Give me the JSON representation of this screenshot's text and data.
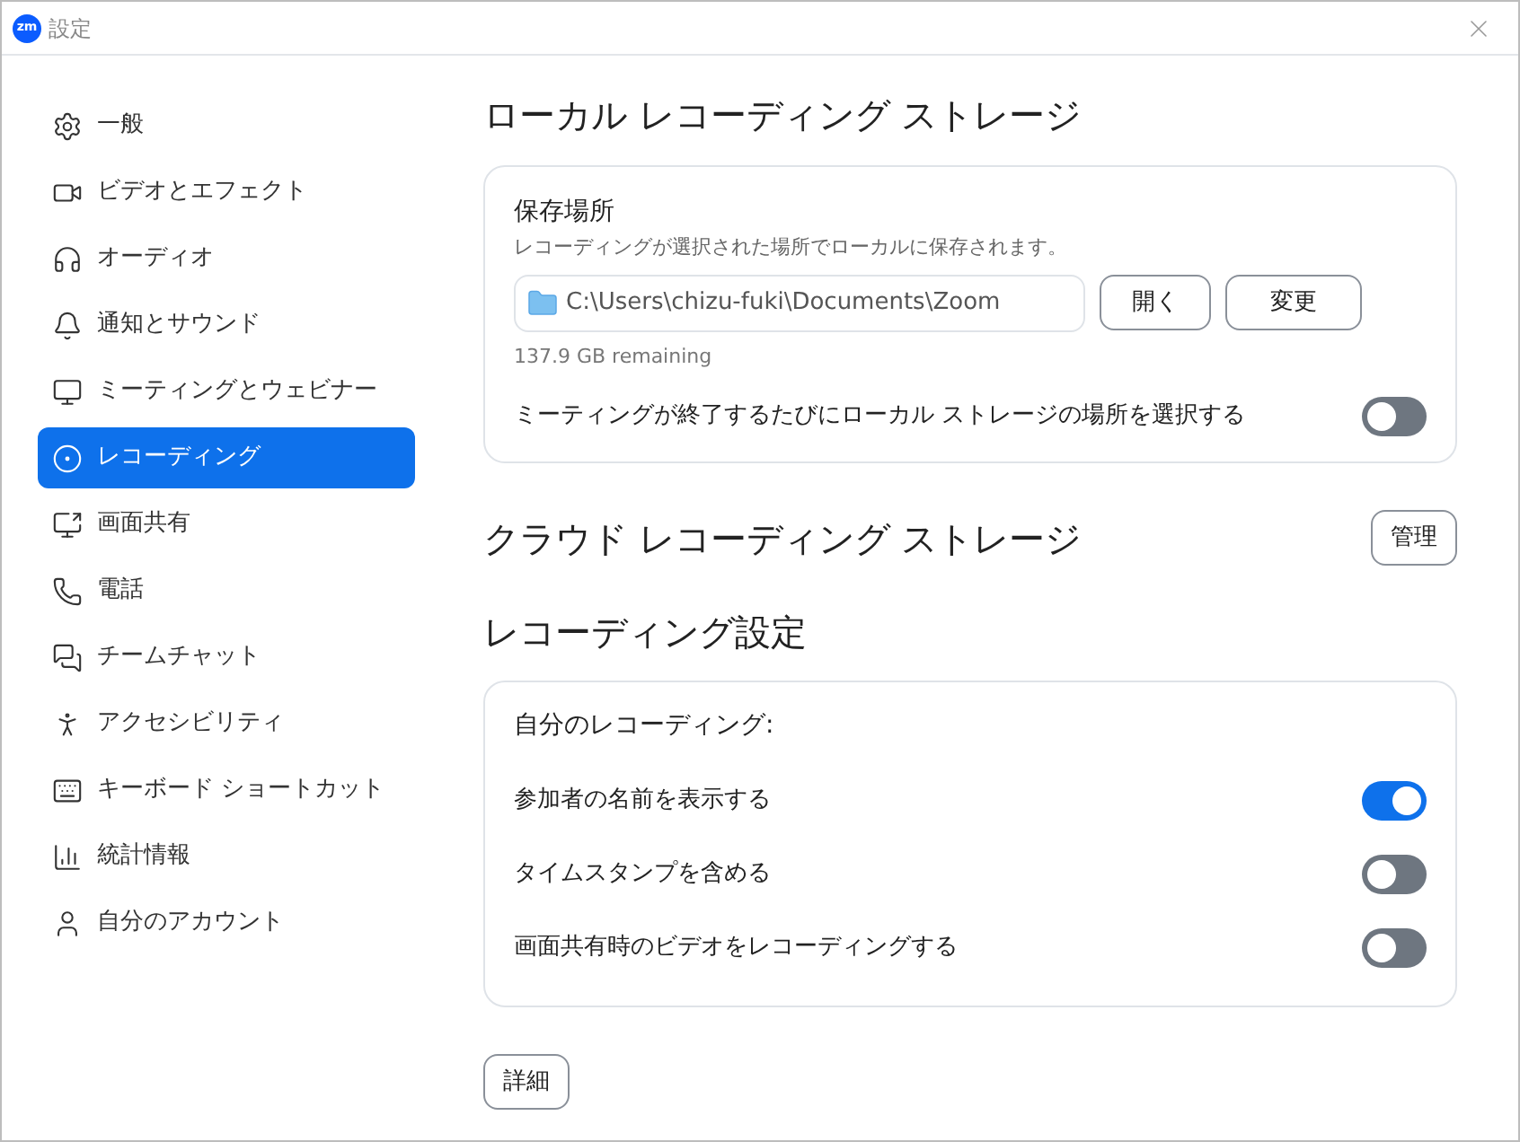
{
  "window": {
    "title": "設定",
    "logo": "zm"
  },
  "sidebar": {
    "items": [
      {
        "label": "一般",
        "selected": false
      },
      {
        "label": "ビデオとエフェクト",
        "selected": false
      },
      {
        "label": "オーディオ",
        "selected": false
      },
      {
        "label": "通知とサウンド",
        "selected": false
      },
      {
        "label": "ミーティングとウェビナー",
        "selected": false
      },
      {
        "label": "レコーディング",
        "selected": true
      },
      {
        "label": "画面共有",
        "selected": false
      },
      {
        "label": "電話",
        "selected": false
      },
      {
        "label": "チームチャット",
        "selected": false
      },
      {
        "label": "アクセシビリティ",
        "selected": false
      },
      {
        "label": "キーボード ショートカット",
        "selected": false
      },
      {
        "label": "統計情報",
        "selected": false
      },
      {
        "label": "自分のアカウント",
        "selected": false
      }
    ]
  },
  "local_storage": {
    "heading": "ローカル レコーディング ストレージ",
    "title": "保存場所",
    "description": "レコーディングが選択された場所でローカルに保存されます。",
    "path": "C:\\Users\\chizu-fuki\\Documents\\Zoom",
    "buttons": [
      "開く",
      "変更"
    ],
    "remaining": "137.9 GB remaining",
    "choose_toggle": {
      "label": "ミーティングが終了するたびにローカル ストレージの場所を選択する",
      "on": false
    }
  },
  "cloud_storage": {
    "heading": "クラウド レコーディング ストレージ",
    "button": "管理"
  },
  "recording_settings": {
    "heading": "レコーディング設定",
    "subtitle": "自分のレコーディング:",
    "toggles": [
      {
        "label": "参加者の名前を表示する",
        "on": true
      },
      {
        "label": "タイムスタンプを含める",
        "on": false
      },
      {
        "label": "画面共有時のビデオをレコーディングする",
        "on": false
      }
    ]
  },
  "details_button": "詳細"
}
